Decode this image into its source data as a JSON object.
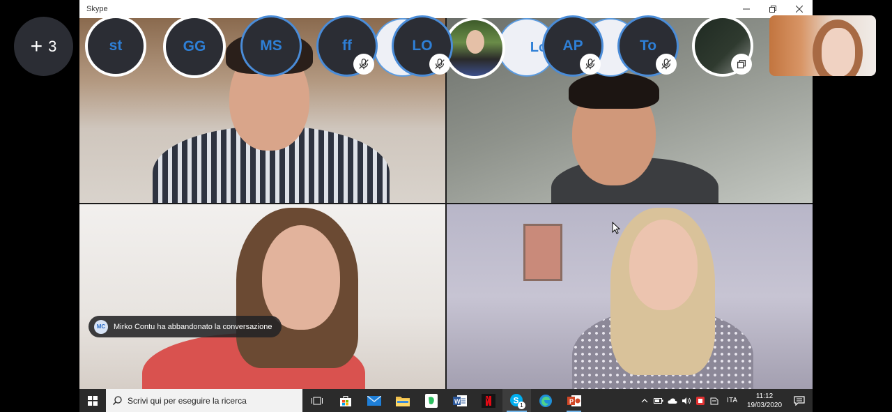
{
  "window": {
    "title": "Skype"
  },
  "overflow": {
    "label": "3"
  },
  "participants": [
    {
      "initials": "st",
      "muted": false
    },
    {
      "initials": "GG",
      "muted": false
    },
    {
      "initials": "MS",
      "muted": false
    },
    {
      "initials": "ff",
      "muted": true
    },
    {
      "initials": "LO",
      "muted": true
    },
    {
      "initials": "AP",
      "muted": true
    },
    {
      "initials": "To",
      "muted": true
    }
  ],
  "partial_avatars": [
    "Lo"
  ],
  "toast": {
    "badge": "MC",
    "message": "Mirko Contu ha abbandonato la conversazione"
  },
  "taskbar": {
    "search_placeholder": "Scrivi qui per eseguire la ricerca",
    "apps": [
      "task-view",
      "store",
      "mail",
      "file-explorer",
      "evernote",
      "word",
      "netflix",
      "skype",
      "edge",
      "powerpoint"
    ],
    "skype_badge": "1",
    "language": "ITA",
    "time": "11:12",
    "date": "19/03/2020"
  },
  "colors": {
    "accent": "#2e7fd6",
    "avatar_bg": "#2b2d34",
    "taskbar": "#2b2b2b"
  }
}
